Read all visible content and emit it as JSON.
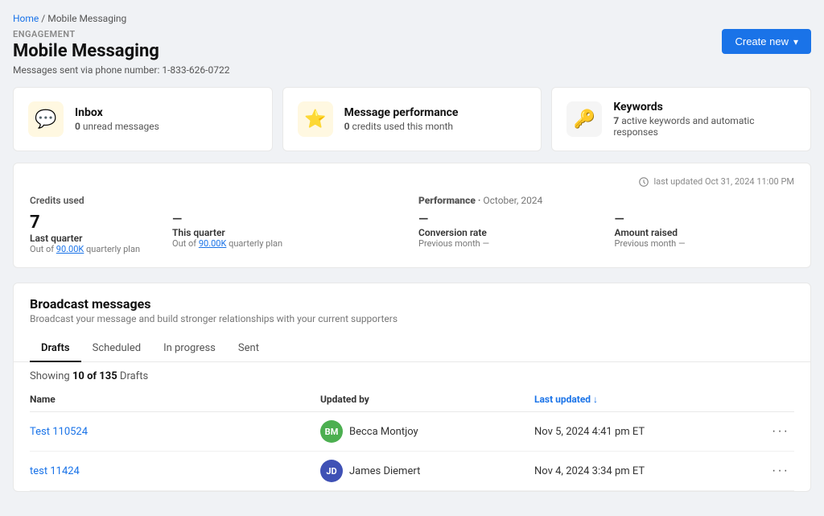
{
  "breadcrumb": {
    "home": "Home",
    "separator": "/",
    "current": "Mobile Messaging"
  },
  "header": {
    "section_label": "ENGAGEMENT",
    "title": "Mobile Messaging",
    "phone_number": "Messages sent via phone number: 1-833-626-0722",
    "create_button": "Create new"
  },
  "stat_cards": [
    {
      "id": "inbox",
      "icon": "💬",
      "icon_type": "inbox",
      "title": "Inbox",
      "value": "0",
      "description": "unread messages"
    },
    {
      "id": "performance",
      "icon": "⭐",
      "icon_type": "perf",
      "title": "Message performance",
      "value": "0",
      "description": "credits used this month"
    },
    {
      "id": "keywords",
      "icon": "🔑",
      "icon_type": "keywords",
      "title": "Keywords",
      "value": "7",
      "description": "active keywords and automatic responses"
    }
  ],
  "performance_panel": {
    "last_updated": "last updated Oct 31, 2024 11:00 PM",
    "credits_label": "Credits used",
    "last_quarter": {
      "value": "7",
      "label": "Last quarter",
      "sub": "Out of 90.00K quarterly plan"
    },
    "this_quarter": {
      "value": "—",
      "label": "This quarter",
      "sub": "Out of 90.00K quarterly plan"
    },
    "performance_label": "Performance",
    "performance_period": "October, 2024",
    "conversion_rate": {
      "value": "—",
      "label": "Conversion rate",
      "sub": "Previous month —"
    },
    "amount_raised": {
      "value": "—",
      "label": "Amount raised",
      "sub": "Previous month —"
    }
  },
  "broadcast": {
    "title": "Broadcast messages",
    "subtitle": "Broadcast your message and build stronger relationships with your current supporters",
    "tabs": [
      "Drafts",
      "Scheduled",
      "In progress",
      "Sent"
    ],
    "active_tab": "Drafts",
    "showing_text": "Showing",
    "showing_count": "10 of 135",
    "showing_label": "Drafts",
    "table": {
      "columns": [
        {
          "label": "Name",
          "sort": false
        },
        {
          "label": "Updated by",
          "sort": false
        },
        {
          "label": "Last updated ↓",
          "sort": true
        },
        {
          "label": "",
          "sort": false
        }
      ],
      "rows": [
        {
          "name": "Test 110524",
          "updated_by_initials": "BM",
          "updated_by_name": "Becca Montjoy",
          "updated_by_color": "green",
          "last_updated": "Nov 5, 2024 4:41 pm ET"
        },
        {
          "name": "test 11424",
          "updated_by_initials": "JD",
          "updated_by_name": "James Diemert",
          "updated_by_color": "blue",
          "last_updated": "Nov 4, 2024 3:34 pm ET"
        }
      ]
    }
  }
}
